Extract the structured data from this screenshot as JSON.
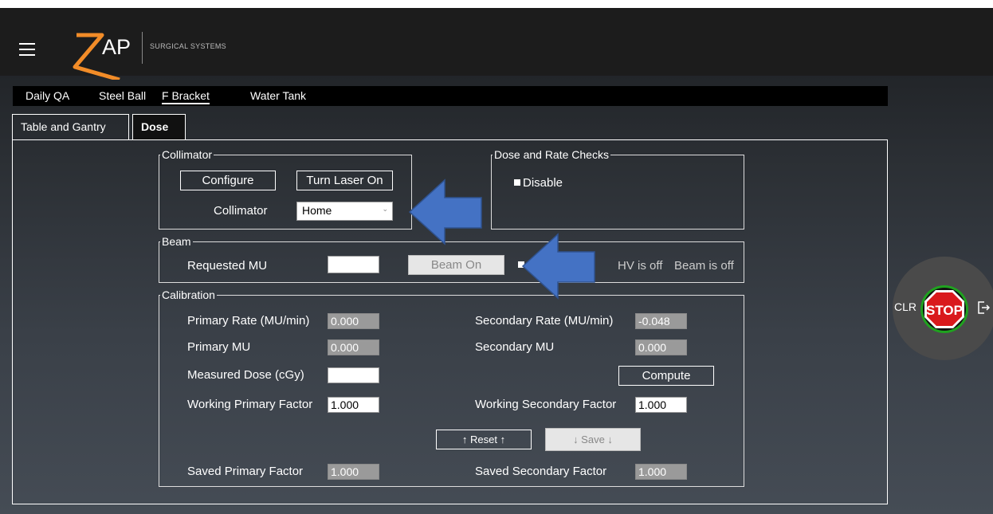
{
  "header": {
    "logo_text": "AP",
    "logo_subtitle": "SURGICAL SYSTEMS"
  },
  "main_tabs": [
    {
      "label": "Daily QA"
    },
    {
      "label": "Steel Ball"
    },
    {
      "label": "F Bracket",
      "active": true
    },
    {
      "label": "Water Tank"
    }
  ],
  "sub_tabs": [
    {
      "label": "Table and Gantry"
    },
    {
      "label": "Dose",
      "active": true
    }
  ],
  "collimator": {
    "legend": "Collimator",
    "configure": "Configure",
    "laser": "Turn Laser On",
    "label": "Collimator",
    "selected": "Home"
  },
  "dose_checks": {
    "legend": "Dose and Rate Checks",
    "disable": "Disable"
  },
  "beam": {
    "legend": "Beam",
    "requested_mu": "Requested MU",
    "requested_mu_value": "",
    "beam_on": "Beam On",
    "hv_status": "HV is off",
    "beam_status": "Beam is off"
  },
  "calibration": {
    "legend": "Calibration",
    "primary_rate_label": "Primary Rate (MU/min)",
    "primary_rate": "0.000",
    "primary_mu_label": "Primary MU",
    "primary_mu": "0.000",
    "measured_dose_label": "Measured Dose (cGy)",
    "measured_dose": "",
    "working_primary_label": "Working Primary Factor",
    "working_primary": "1.000",
    "saved_primary_label": "Saved Primary Factor",
    "saved_primary": "1.000",
    "secondary_rate_label": "Secondary Rate (MU/min)",
    "secondary_rate": "-0.048",
    "secondary_mu_label": "Secondary MU",
    "secondary_mu": "0.000",
    "compute": "Compute",
    "working_secondary_label": "Working Secondary Factor",
    "working_secondary": "1.000",
    "saved_secondary_label": "Saved Secondary Factor",
    "saved_secondary": "1.000",
    "reset": "↑ Reset ↑",
    "save": "↓ Save ↓"
  },
  "side": {
    "clr": "CLR",
    "stop": "STOP"
  },
  "icons": {
    "menu": "hamburger-menu-icon",
    "logout": "logout-icon",
    "arrows": "blue-annotation-arrow"
  },
  "colors": {
    "arrow_blue": "#4472c4",
    "stop_red": "#d9191c",
    "stop_ring": "#1fa21f"
  }
}
